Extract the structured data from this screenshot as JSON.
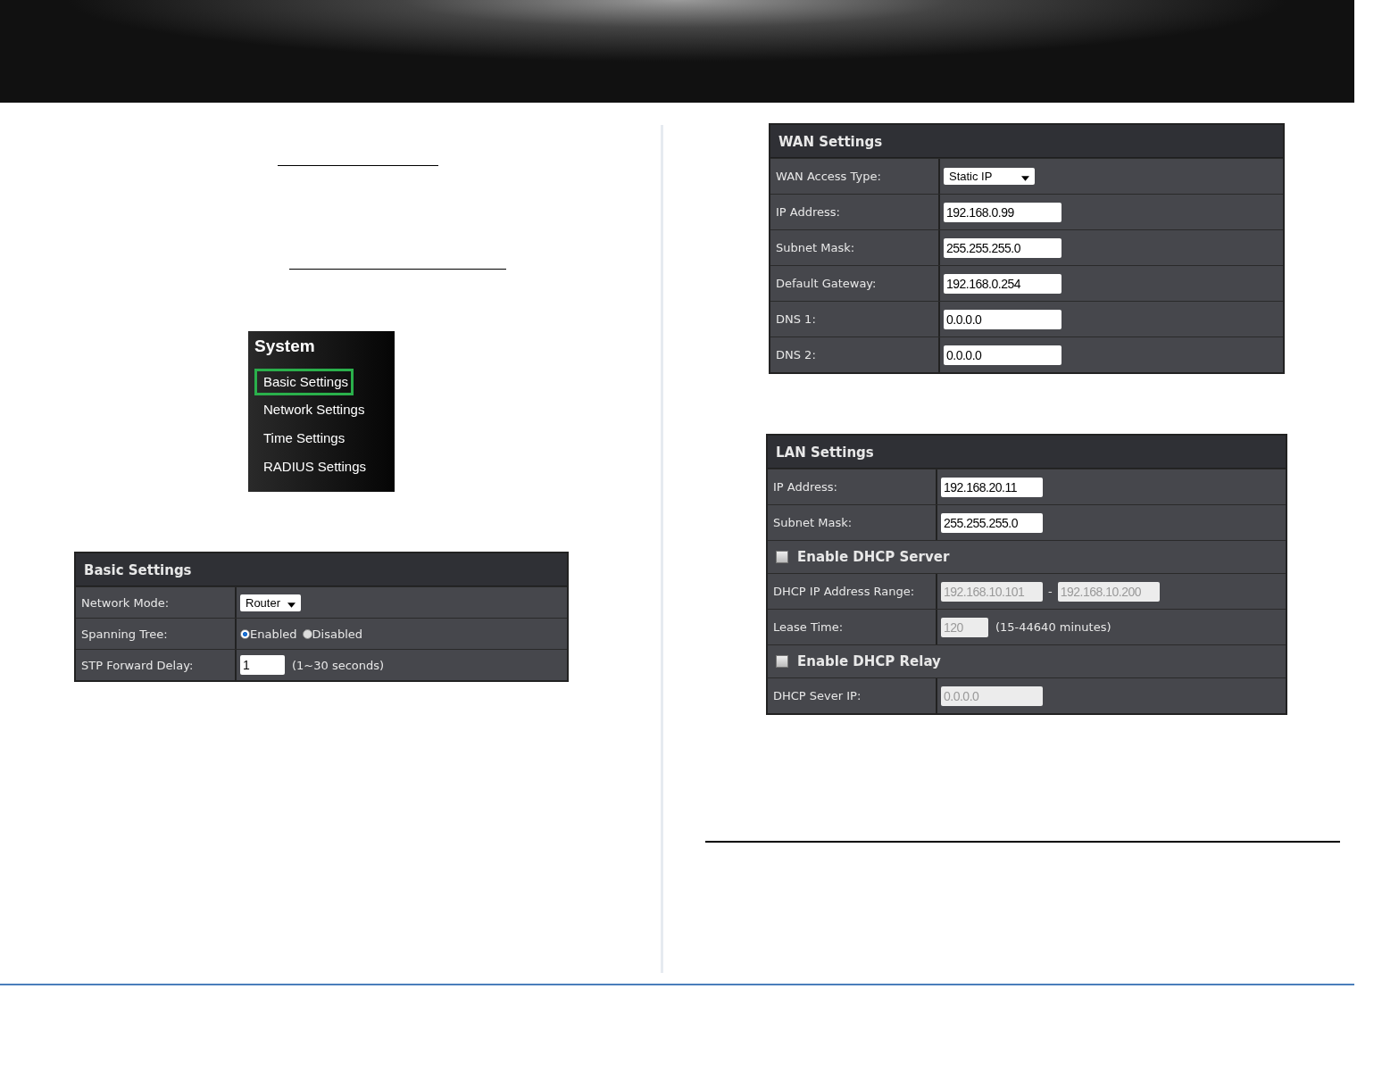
{
  "system_menu": {
    "title": "System",
    "items": [
      {
        "label": "Basic Settings",
        "selected": true
      },
      {
        "label": "Network Settings",
        "selected": false
      },
      {
        "label": "Time Settings",
        "selected": false
      },
      {
        "label": "RADIUS Settings",
        "selected": false
      }
    ]
  },
  "basic_settings": {
    "title": "Basic Settings",
    "rows": [
      {
        "kind": "select",
        "label": "Network Mode:",
        "value": "Router"
      },
      {
        "kind": "radio",
        "label": "Spanning Tree:",
        "options": [
          {
            "label": "Enabled",
            "selected": true
          },
          {
            "label": "Disabled",
            "selected": false
          }
        ]
      },
      {
        "kind": "input",
        "label": "STP Forward Delay:",
        "value": "1",
        "hint": "(1~30 seconds)",
        "disabled": false
      }
    ]
  },
  "wan_settings": {
    "title": "WAN Settings",
    "rows": [
      {
        "kind": "select",
        "label": "WAN Access Type:",
        "value": "Static IP"
      },
      {
        "kind": "input",
        "label": "IP Address:",
        "value": "192.168.0.99",
        "disabled": false
      },
      {
        "kind": "input",
        "label": "Subnet Mask:",
        "value": "255.255.255.0",
        "disabled": false
      },
      {
        "kind": "input",
        "label": "Default Gateway:",
        "value": "192.168.0.254",
        "disabled": false
      },
      {
        "kind": "input",
        "label": "DNS 1:",
        "value": "0.0.0.0",
        "disabled": false
      },
      {
        "kind": "input",
        "label": "DNS 2:",
        "value": "0.0.0.0",
        "disabled": false
      }
    ]
  },
  "lan_settings": {
    "title": "LAN Settings",
    "rows": [
      {
        "kind": "input",
        "label": "IP Address:",
        "value": "192.168.20.11",
        "disabled": false
      },
      {
        "kind": "input",
        "label": "Subnet Mask:",
        "value": "255.255.255.0",
        "disabled": false
      },
      {
        "kind": "checkbox",
        "label": "Enable DHCP Server",
        "checked": false
      },
      {
        "kind": "range",
        "label": "DHCP IP Address Range:",
        "from": "192.168.10.101",
        "separator": "-",
        "to": "192.168.10.200",
        "disabled": true
      },
      {
        "kind": "input",
        "label": "Lease Time:",
        "value": "120",
        "hint": "(15-44640 minutes)",
        "disabled": true
      },
      {
        "kind": "checkbox",
        "label": "Enable DHCP Relay",
        "checked": false
      },
      {
        "kind": "input",
        "label": "DHCP Sever IP:",
        "value": "0.0.0.0",
        "disabled": true
      }
    ]
  }
}
